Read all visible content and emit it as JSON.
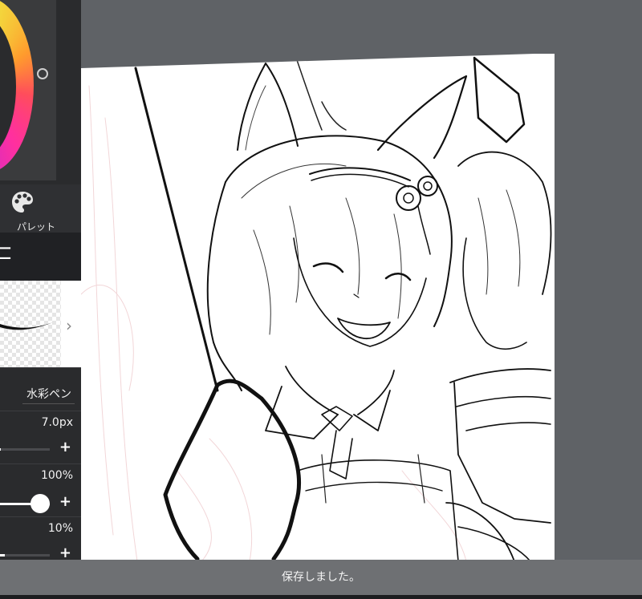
{
  "sidebar": {
    "palette_label": "パレット",
    "brush_name": "水彩ペン",
    "size_value": "7.0px",
    "opacity_value": "100%",
    "third_value": "10%",
    "plus_symbol": "+",
    "icons": {
      "palette": "palette-icon",
      "chevron": "chevron-right-icon",
      "plus": "plus-icon"
    }
  },
  "toast": {
    "message": "保存しました。"
  },
  "levels": {
    "size_fraction": 0.02,
    "opacity_fraction": 1.0,
    "third_fraction": 0.1
  },
  "colors": {
    "sidebar_bg": "#2a2b2d",
    "workspace_bg": "#5f6266",
    "toast_bg": "#6e7073",
    "current_color": "#ff2b2b"
  }
}
